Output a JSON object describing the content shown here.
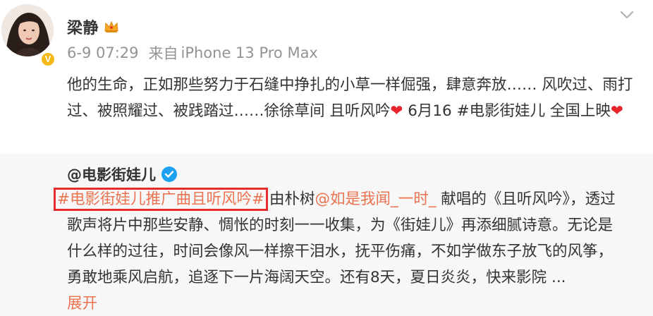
{
  "post": {
    "author": "梁静",
    "badge_icon": "crown-icon",
    "verified_icon": "verified-v-icon",
    "timestamp": "6-9 07:29",
    "source_label": "来自",
    "device": "iPhone 13 Pro Max",
    "text_part1": "他的生命，正如那些努力于石缝中挣扎的小草一样倔强，肆意奔放…… 风吹过、雨打过、被照耀过、被践踏过……徐徐草间 且听风吟",
    "text_part2": " 6月16 #电影街娃儿 全国上映",
    "heart": "❤"
  },
  "repost": {
    "author": "@电影街娃儿",
    "verified_icon": "verified-blue-icon",
    "topic": "#电影街娃儿推广曲且听风吟#",
    "text_a": "由朴树",
    "mention": "@如是我闻_一时_",
    "text_b": " 献唱的《且听风吟》，透过歌声将片中那些安静、惆怅的时刻一一收集，为《街娃儿》再添细腻诗意。无论是什么样的过往，时间会像风一样擦干泪水，抚平伤痛，不如学做东子放飞的风筝，勇敢地乘风启航，追逐下一片海阔天空。还有8天，夏日炎炎，快来影院 ...",
    "expand_label": "展开"
  },
  "colors": {
    "link": "#eb7350",
    "highlight_box": "#e62b2b",
    "heart": "#e8242c",
    "repost_bg": "#f7f7f7",
    "meta_text": "#939393"
  }
}
